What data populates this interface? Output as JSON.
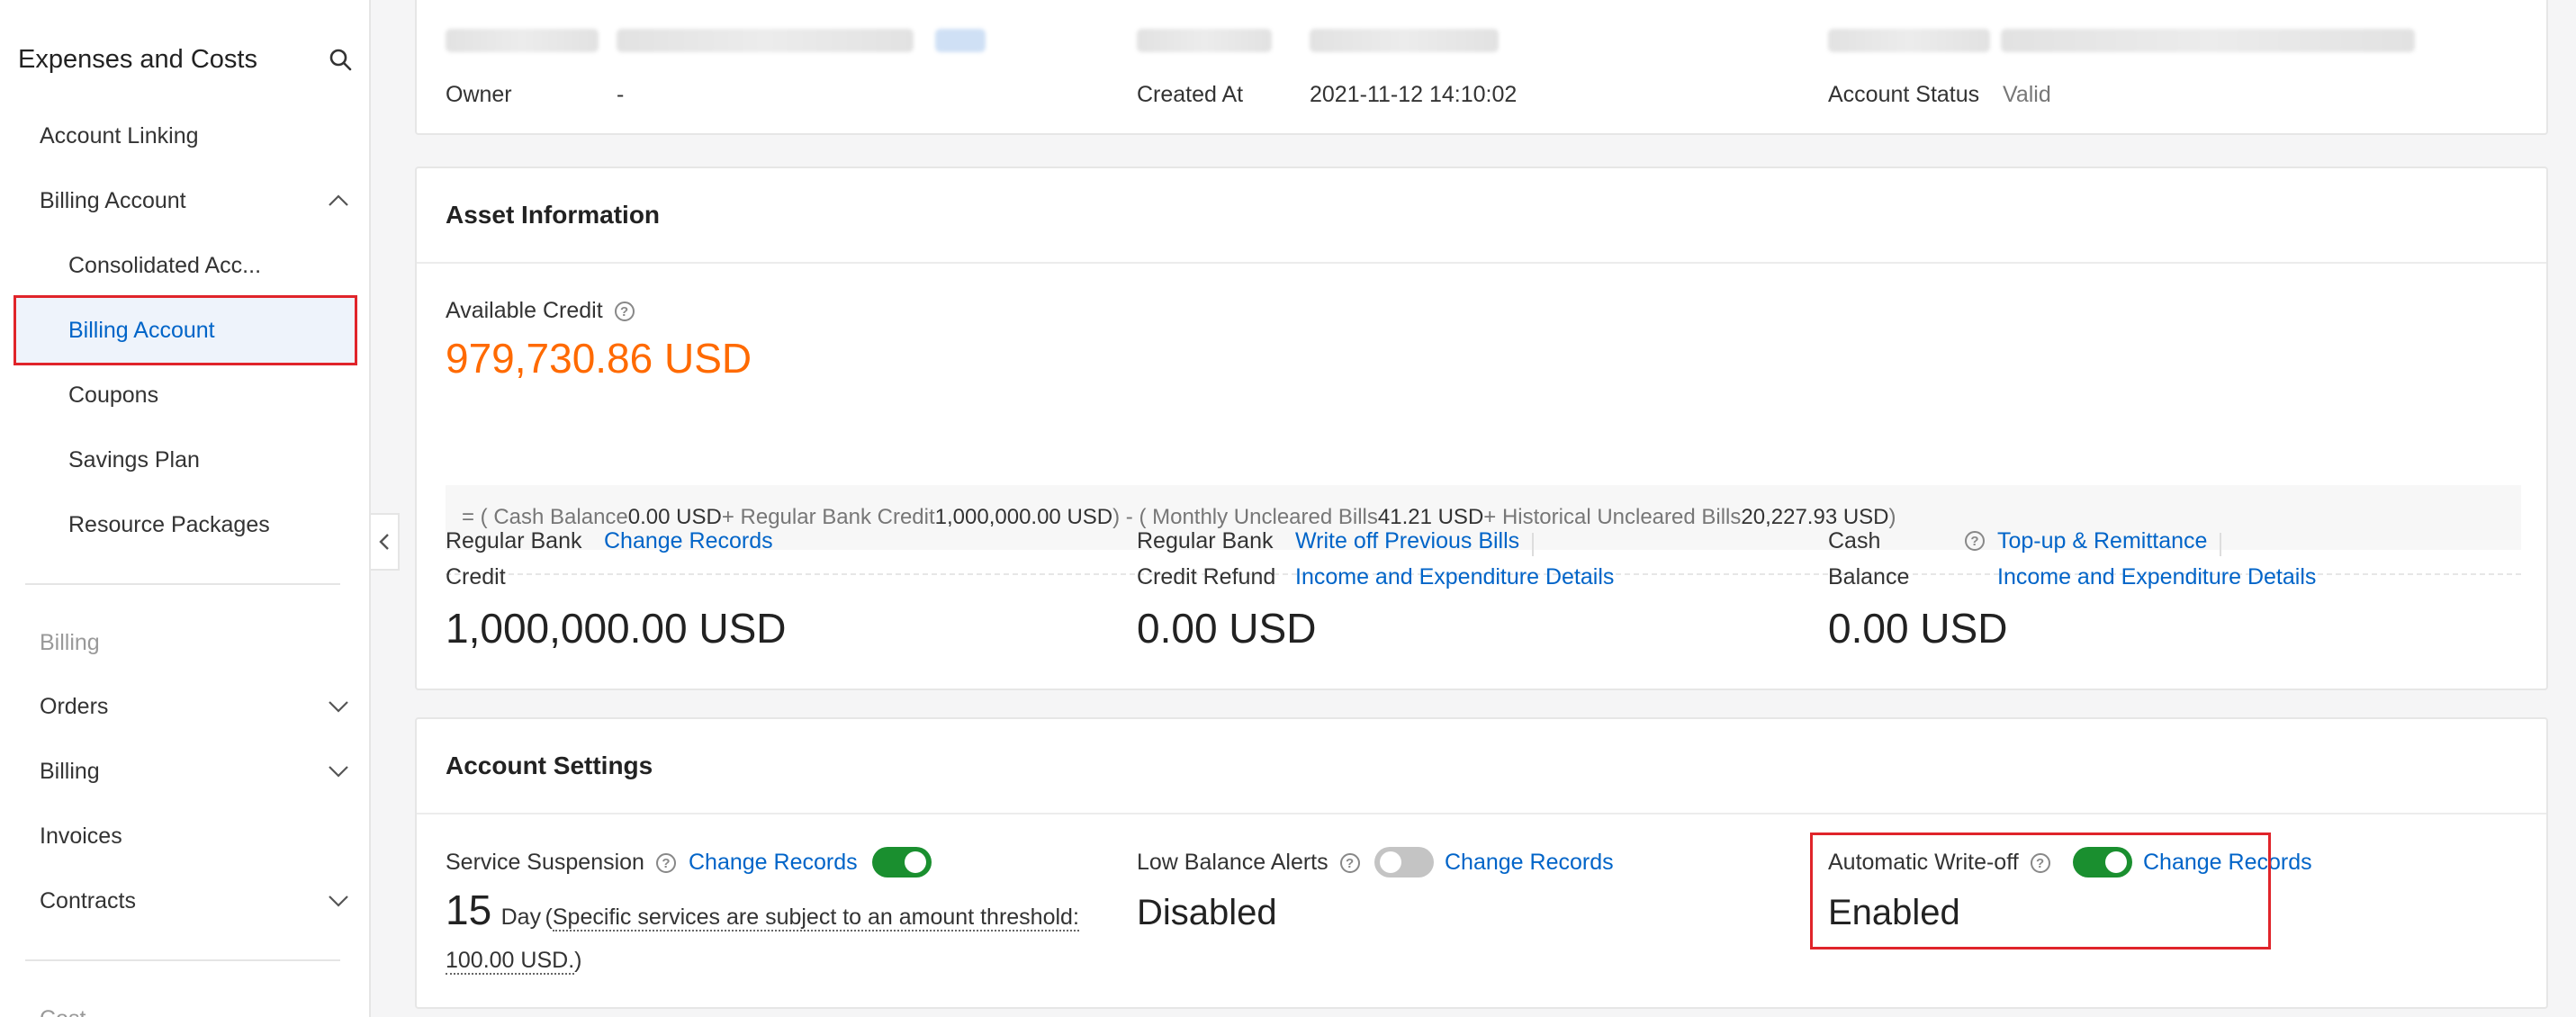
{
  "sidebar": {
    "title": "Expenses and Costs",
    "items": {
      "account_linking": "Account Linking",
      "billing_account_group": "Billing Account",
      "consolidated": "Consolidated Acc...",
      "billing_account": "Billing Account",
      "coupons": "Coupons",
      "savings_plan": "Savings Plan",
      "resource_packages": "Resource Packages",
      "billing_group": "Billing",
      "orders": "Orders",
      "billing": "Billing",
      "invoices": "Invoices",
      "contracts": "Contracts",
      "cost_group": "Cost"
    }
  },
  "account_info": {
    "owner_label": "Owner",
    "owner_value": "-",
    "created_label": "Created At",
    "created_value": "2021-11-12 14:10:02",
    "status_label": "Account Status",
    "status_value": "Valid"
  },
  "asset": {
    "title": "Asset Information",
    "available_label": "Available Credit",
    "available_value": "979,730.86 USD",
    "formula": {
      "open1": "=   ( Cash Balance ",
      "cash": "0.00 USD",
      "plus1": " + Regular Bank Credit ",
      "bank": "1,000,000.00 USD",
      "close1_minus": ")   -   ( Monthly Uncleared Bills ",
      "monthly": "41.21 USD",
      "plus2": " + Historical Uncleared Bills ",
      "historical": "20,227.93 USD",
      "close2": " )"
    },
    "bank_credit": {
      "label1": "Regular Bank",
      "label2": "Credit",
      "link": "Change Records",
      "value": "1,000,000.00 USD"
    },
    "bank_refund": {
      "label1": "Regular Bank",
      "label2": "Credit Refund",
      "link1": "Write off Previous Bills",
      "link2": "Income and Expenditure Details",
      "value": "0.00 USD"
    },
    "cash": {
      "label1": "Cash",
      "label2": "Balance",
      "link1": "Top-up & Remittance",
      "link2": "Income and Expenditure Details",
      "value": "0.00 USD"
    }
  },
  "settings": {
    "title": "Account Settings",
    "suspension": {
      "label": "Service Suspension",
      "link": "Change Records",
      "enabled": true,
      "days": "15",
      "unit": "Day",
      "note_open": "(",
      "note": "Specific services are subject to an amount threshold: 100.00 USD.",
      "note_close": ")"
    },
    "low_balance": {
      "label": "Low Balance Alerts",
      "link": "Change Records",
      "enabled": false,
      "state": "Disabled"
    },
    "auto_writeoff": {
      "label": "Automatic Write-off",
      "link": "Change Records",
      "enabled": true,
      "state": "Enabled"
    }
  },
  "colors": {
    "accent": "#0064c8",
    "orange": "#ff6a00",
    "toggle_on": "#1a8f2f",
    "highlight": "#e0242a"
  }
}
